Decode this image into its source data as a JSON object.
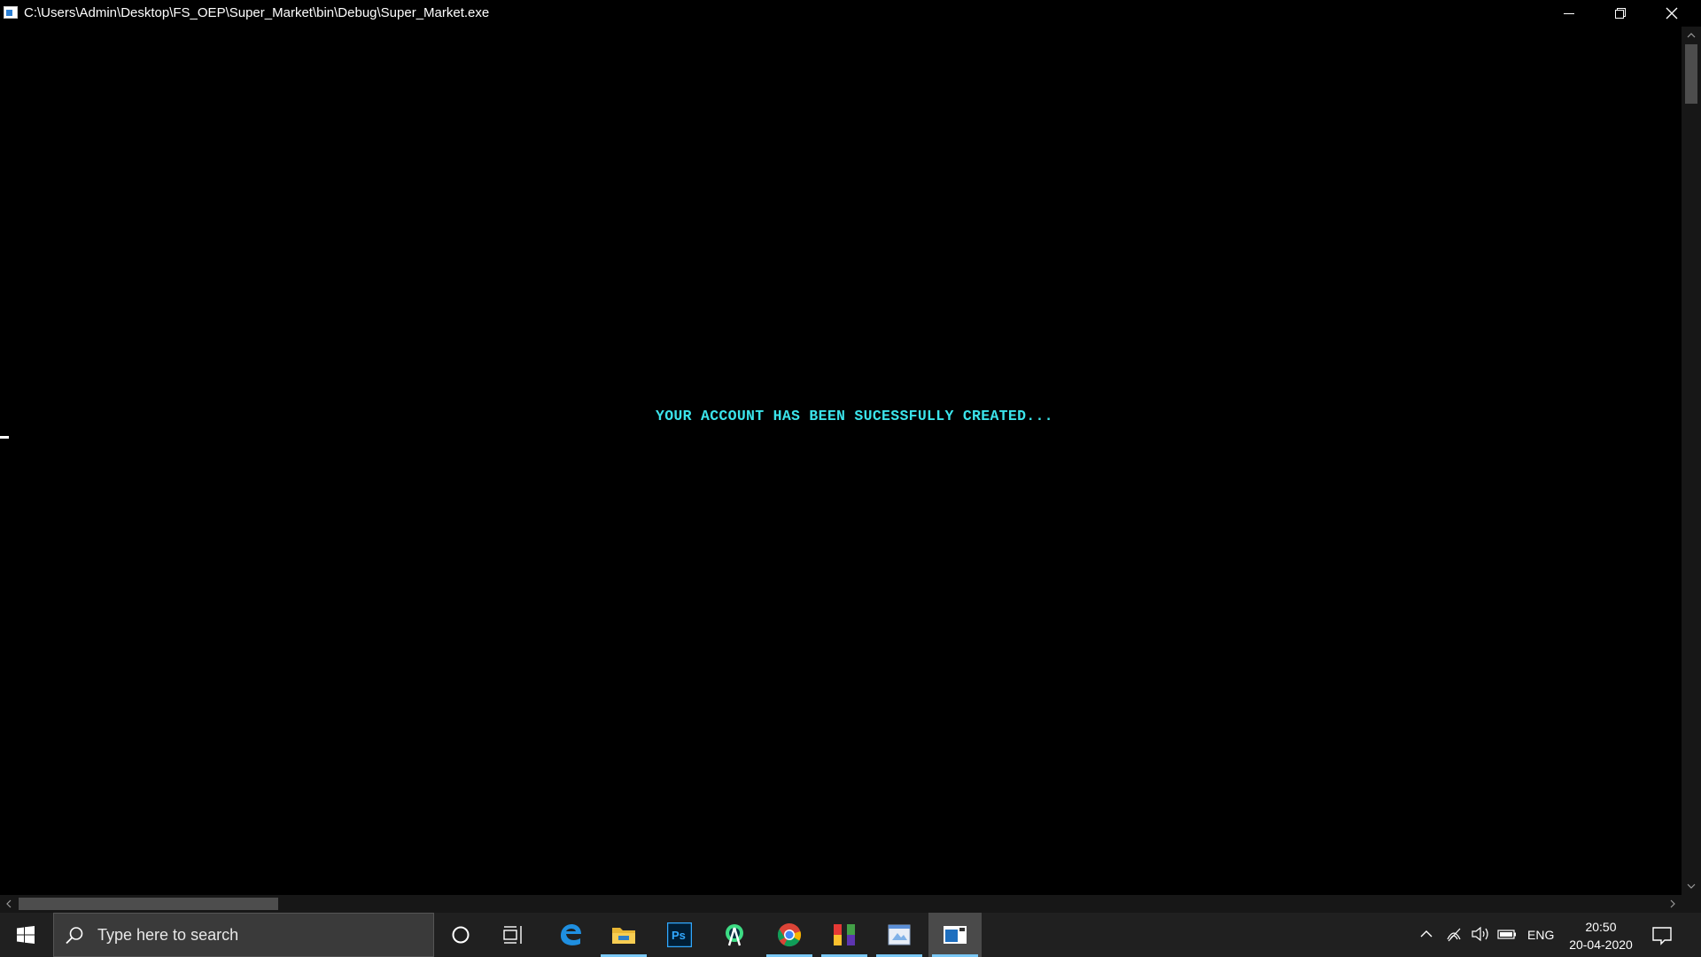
{
  "window": {
    "title": "C:\\Users\\Admin\\Desktop\\FS_OEP\\Super_Market\\bin\\Debug\\Super_Market.exe",
    "controls": {
      "minimize": "minimize-icon",
      "restore": "restore-icon",
      "close": "close-icon"
    }
  },
  "console": {
    "message": "YOUR ACCOUNT HAS BEEN SUCESSFULLY CREATED...",
    "text_color": "#3be3ea",
    "background": "#000000"
  },
  "taskbar": {
    "search_placeholder": "Type here to search",
    "pinned_apps": [
      "cortana-icon",
      "task-view-icon",
      "edge-icon",
      "file-explorer-icon",
      "photoshop-icon",
      "android-studio-icon",
      "chrome-icon",
      "winrar-icon",
      "paint-icon",
      "console-app-icon"
    ],
    "photoshop_label": "Ps",
    "tray": {
      "language": "ENG",
      "time": "20:50",
      "date": "20-04-2020"
    }
  }
}
